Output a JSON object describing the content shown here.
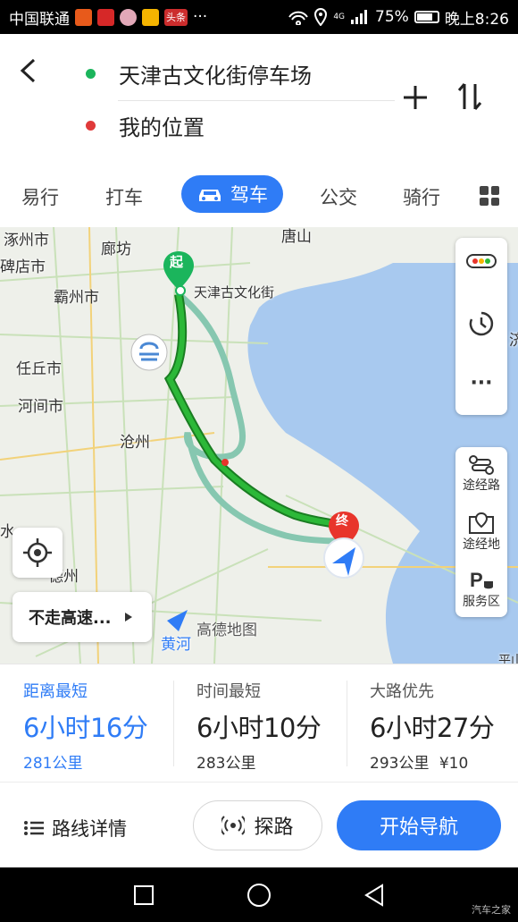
{
  "status_bar": {
    "carrier": "中国联通",
    "network": "4G",
    "battery": "75%",
    "time": "晚上8:26",
    "app_badge": "头条",
    "ellipsis": "···",
    "app_colors": [
      "#e85a1b",
      "#d62828",
      "#e2a8b8",
      "#f5b400",
      "#cc2d2d"
    ]
  },
  "header": {
    "origin": "天津古文化街停车场",
    "destination": "我的位置",
    "origin_color": "#1bb55c",
    "destination_color": "#e03a3a"
  },
  "tabs": [
    "易行",
    "打车",
    "驾车",
    "公交",
    "骑行"
  ],
  "active_tab": "驾车",
  "map": {
    "labels": {
      "zhuozhou": "涿州市",
      "langfang": "廊坊",
      "tangshan": "唐山",
      "beidian": "碑店市",
      "bazhou": "霸州市",
      "renqiu": "任丘市",
      "hejian": "河间市",
      "cangzhou": "沧州",
      "suzhou": "德州",
      "gulture": "天津古文化街",
      "huanghe": "黄河",
      "edge_right": "济",
      "edge_left": "水",
      "edge_ping": "平山"
    },
    "start_marker": "起",
    "end_marker": "终",
    "watermark": "高德地图",
    "controls": {
      "waypoint_route": "途经路",
      "waypoint_place": "途经地",
      "service_area": "服务区",
      "more": "···"
    },
    "avoid_highway": "不走高速...",
    "route_color": "#19a92c",
    "alt_route_color": "#86c7b0",
    "sea_color": "#a8c9ef"
  },
  "route_options": [
    {
      "name": "距离最短",
      "time": "6小时16分",
      "distance": "281公里",
      "selected": true
    },
    {
      "name": "时间最短",
      "time": "6小时10分",
      "distance": "283公里",
      "selected": false
    },
    {
      "name": "大路优先",
      "time": "6小时27分",
      "distance": "293公里",
      "toll": "¥10",
      "selected": false
    }
  ],
  "actions": {
    "details": "路线详情",
    "explore": "探路",
    "start": "开始导航"
  },
  "footer": {
    "watermark": "汽车之家"
  }
}
